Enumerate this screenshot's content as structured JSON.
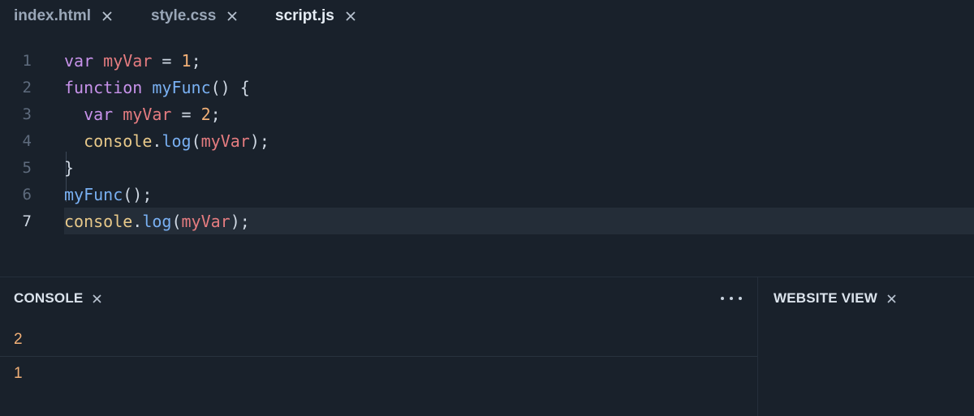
{
  "tabs": [
    {
      "label": "index.html",
      "active": false
    },
    {
      "label": "style.css",
      "active": false
    },
    {
      "label": "script.js",
      "active": true
    }
  ],
  "editor": {
    "current_line": 7,
    "lines": [
      {
        "number": "1",
        "tokens": [
          {
            "text": "var",
            "kind": "kw"
          },
          {
            "text": " ",
            "kind": "pun"
          },
          {
            "text": "myVar",
            "kind": "var"
          },
          {
            "text": " = ",
            "kind": "pun"
          },
          {
            "text": "1",
            "kind": "num"
          },
          {
            "text": ";",
            "kind": "pun"
          }
        ]
      },
      {
        "number": "2",
        "tokens": [
          {
            "text": "function",
            "kind": "kw"
          },
          {
            "text": " ",
            "kind": "pun"
          },
          {
            "text": "myFunc",
            "kind": "fn"
          },
          {
            "text": "() {",
            "kind": "pun"
          }
        ]
      },
      {
        "number": "3",
        "tokens": [
          {
            "text": "  ",
            "kind": "pun"
          },
          {
            "text": "var",
            "kind": "kw"
          },
          {
            "text": " ",
            "kind": "pun"
          },
          {
            "text": "myVar",
            "kind": "var"
          },
          {
            "text": " = ",
            "kind": "pun"
          },
          {
            "text": "2",
            "kind": "num"
          },
          {
            "text": ";",
            "kind": "pun"
          }
        ]
      },
      {
        "number": "4",
        "tokens": [
          {
            "text": "  ",
            "kind": "pun"
          },
          {
            "text": "console",
            "kind": "obj"
          },
          {
            "text": ".",
            "kind": "pun"
          },
          {
            "text": "log",
            "kind": "fn"
          },
          {
            "text": "(",
            "kind": "pun"
          },
          {
            "text": "myVar",
            "kind": "var"
          },
          {
            "text": ");",
            "kind": "pun"
          }
        ]
      },
      {
        "number": "5",
        "tokens": [
          {
            "text": "}",
            "kind": "pun"
          }
        ]
      },
      {
        "number": "6",
        "tokens": [
          {
            "text": "myFunc",
            "kind": "fn"
          },
          {
            "text": "();",
            "kind": "pun"
          }
        ]
      },
      {
        "number": "7",
        "tokens": [
          {
            "text": "console",
            "kind": "obj"
          },
          {
            "text": ".",
            "kind": "pun"
          },
          {
            "text": "log",
            "kind": "fn"
          },
          {
            "text": "(",
            "kind": "pun"
          },
          {
            "text": "myVar",
            "kind": "var"
          },
          {
            "text": ");",
            "kind": "pun"
          }
        ]
      }
    ]
  },
  "console": {
    "title": "CONSOLE",
    "more_icon": "ellipsis-icon",
    "output": [
      "2",
      "1"
    ]
  },
  "website_view": {
    "title": "WEBSITE VIEW"
  },
  "colors": {
    "background": "#19212b",
    "keyword": "#c792ea",
    "variable": "#e57c80",
    "number": "#f2b077",
    "function": "#79b0f2",
    "object": "#e8c98a",
    "current_line": "#242d38"
  }
}
